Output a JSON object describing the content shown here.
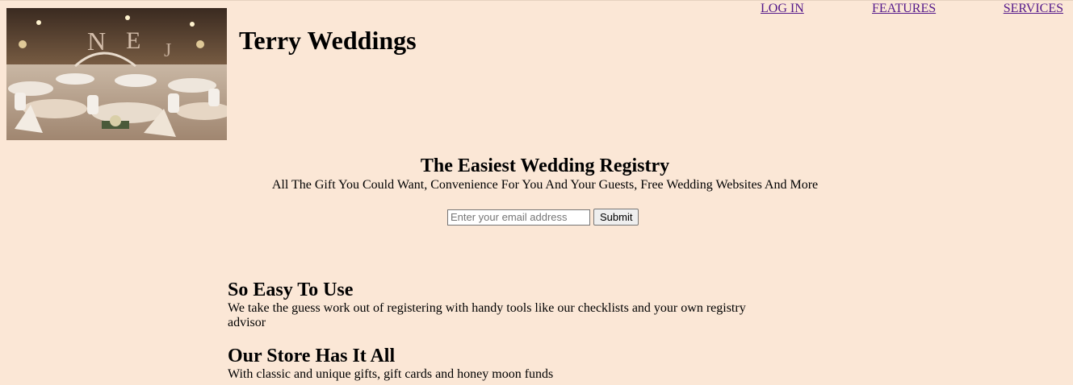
{
  "site": {
    "title": "Terry Weddings",
    "hero_image_alt": "Wedding reception hall with decorated tables"
  },
  "nav": {
    "login": "LOG IN",
    "features": "FEATURES",
    "services": "SERVICES"
  },
  "registry": {
    "heading": "The Easiest Wedding Registry",
    "subheading": "All The Gift You Could Want, Convenience For You And Your Guests, Free Wedding Websites And More",
    "email_placeholder": "Enter your email address",
    "submit_label": "Submit"
  },
  "features": [
    {
      "title": "So Easy To Use",
      "text": "We take the guess work out of registering with handy tools like our checklists and your own registry advisor"
    },
    {
      "title": "Our Store Has It All",
      "text": "With classic and unique gifts, gift cards and honey moon funds"
    }
  ],
  "colors": {
    "background": "#fbe7d6",
    "link": "#551a8b"
  }
}
